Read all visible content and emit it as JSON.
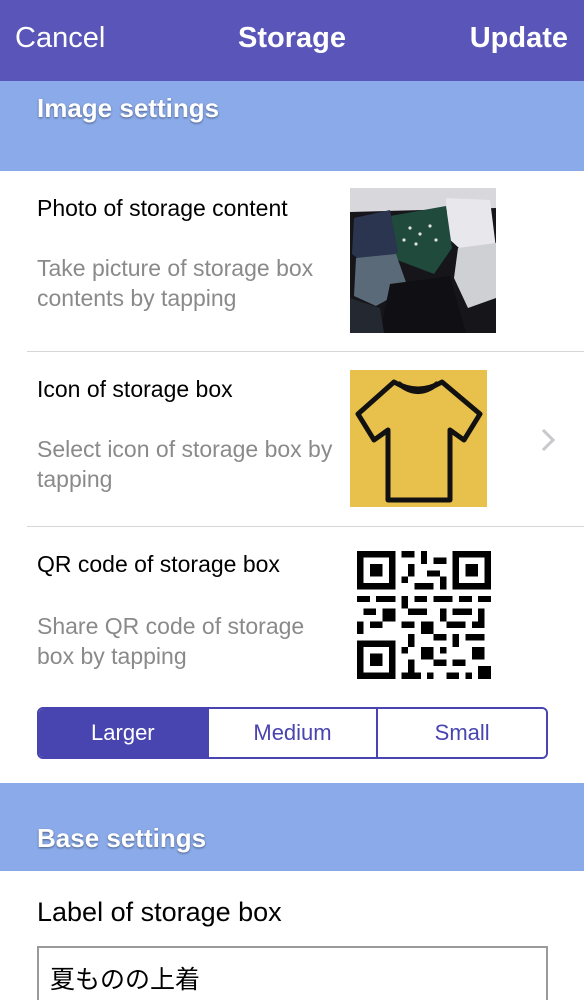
{
  "nav": {
    "cancel": "Cancel",
    "title": "Storage",
    "update": "Update"
  },
  "image_settings": {
    "header": "Image settings",
    "photo": {
      "title": "Photo of storage content",
      "description": "Take picture of storage box contents by tapping"
    },
    "icon": {
      "title": "Icon of storage box",
      "description": "Select icon of storage box by tapping",
      "icon_name": "t-shirt-icon",
      "icon_bg": "#e8c04c"
    },
    "qr": {
      "title": "QR code of storage box",
      "description": "Share QR code of storage box by tapping"
    },
    "size_options": [
      "Larger",
      "Medium",
      "Small"
    ],
    "size_selected": "Larger"
  },
  "base_settings": {
    "header": "Base settings",
    "label_title": "Label of storage box",
    "label_value": "夏ものの上着"
  },
  "colors": {
    "navbar": "#5a55b8",
    "section_header": "#8aaaea",
    "accent": "#4844b0"
  }
}
